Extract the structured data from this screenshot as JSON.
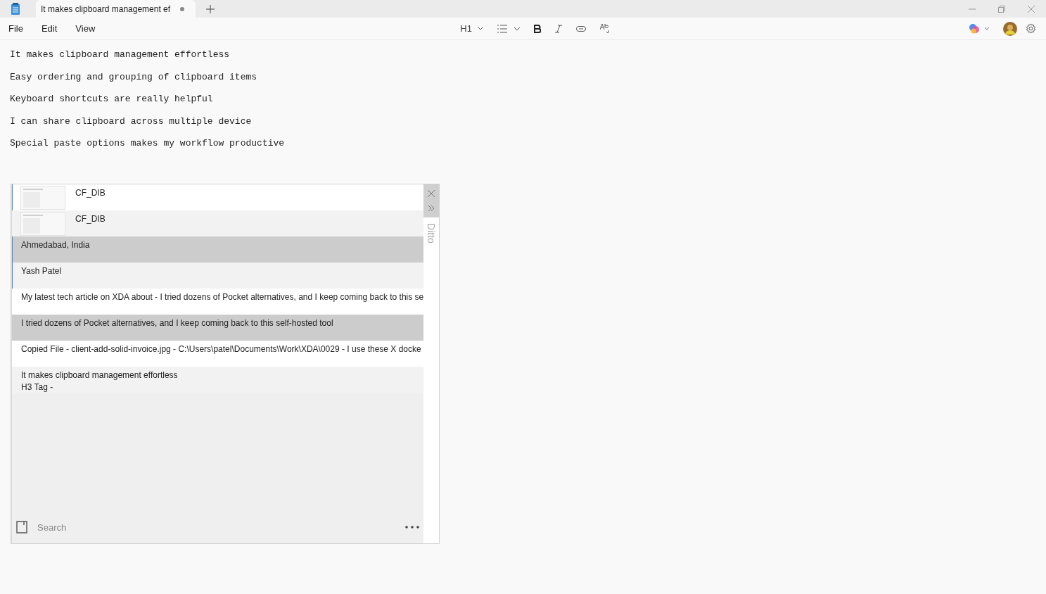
{
  "tab": {
    "title": "It makes clipboard management ef",
    "unsaved": true
  },
  "menu": [
    "File",
    "Edit",
    "View"
  ],
  "toolbar": {
    "heading": "H1"
  },
  "lines": [
    "It makes clipboard management effortless",
    "Easy ordering and grouping of clipboard items",
    "Keyboard shortcuts are really helpful",
    "I can share clipboard across multiple device",
    "Special paste options makes my workflow productive"
  ],
  "ditto": {
    "title": "Ditto",
    "items": [
      {
        "kind": "image",
        "text": "CF_DIB",
        "selected": false,
        "marked": true
      },
      {
        "kind": "image",
        "text": "CF_DIB",
        "selected": false,
        "marked": false
      },
      {
        "kind": "text",
        "text": "Ahmedabad, India",
        "selected": true,
        "marked": true
      },
      {
        "kind": "text",
        "text": "Yash Patel",
        "selected": false,
        "marked": true
      },
      {
        "kind": "text",
        "text": "My latest tech article on XDA about - I tried dozens of Pocket alternatives, and I keep coming back to this se",
        "selected": false,
        "marked": false
      },
      {
        "kind": "text",
        "text": "I tried dozens of Pocket alternatives, and I keep coming back to this self-hosted tool",
        "selected": true,
        "marked": false
      },
      {
        "kind": "text",
        "text": "Copied File - client-add-solid-invoice.jpg - C:\\Users\\patel\\Documents\\Work\\XDA\\0029 - I use these X docke",
        "selected": false,
        "marked": false
      },
      {
        "kind": "text",
        "text": "It makes clipboard management effortless\nH3 Tag -",
        "selected": false,
        "marked": false
      }
    ],
    "search": {
      "placeholder": "Search"
    }
  }
}
